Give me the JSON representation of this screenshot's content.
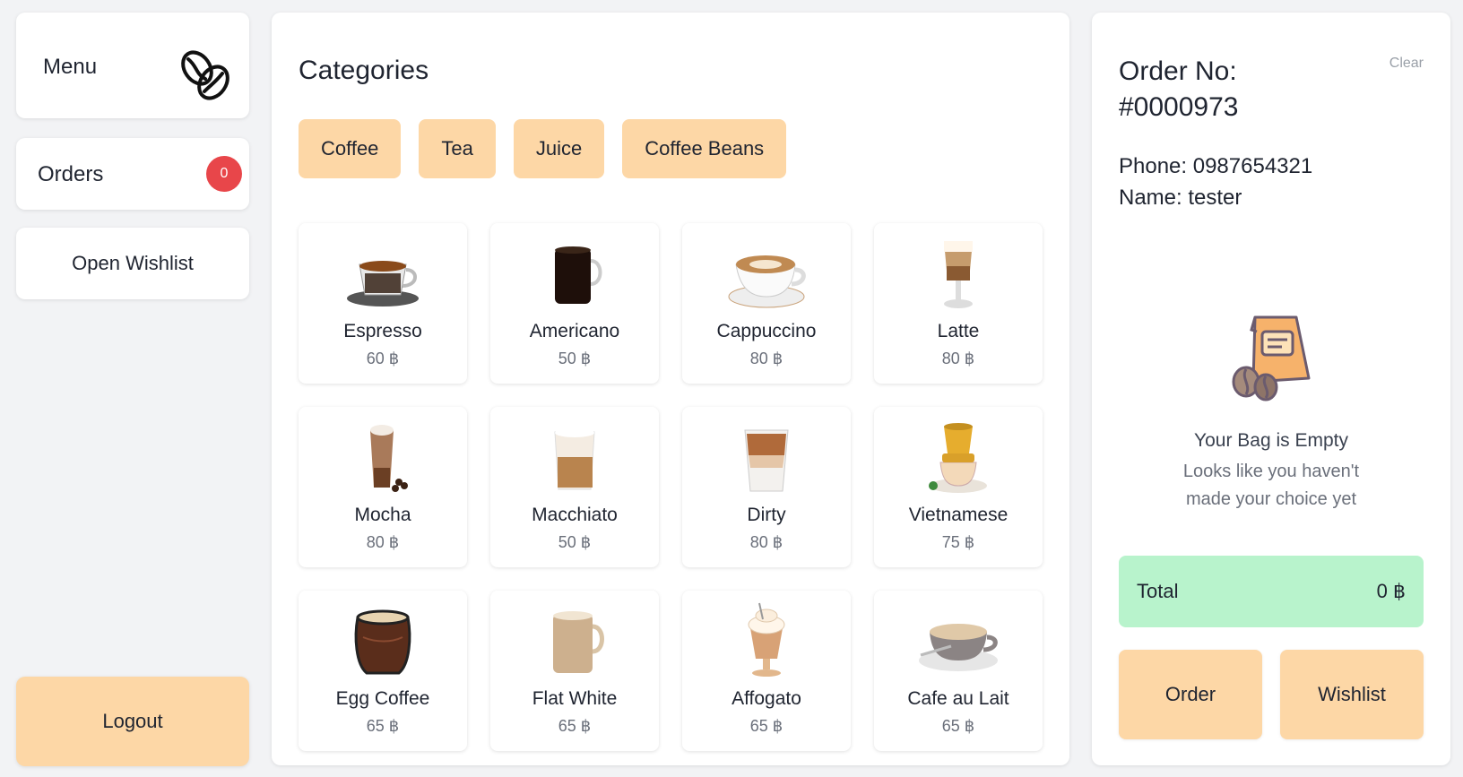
{
  "colors": {
    "accent": "#fdd7a6",
    "badge": "#e8464a",
    "total_bg": "#b8f3cc",
    "page_bg": "#f2f3f5"
  },
  "sidebar": {
    "menu_label": "Menu",
    "menu_icon": "coffee-beans-icon",
    "orders_label": "Orders",
    "orders_count": "0",
    "open_wishlist_label": "Open Wishlist",
    "logout_label": "Logout"
  },
  "main": {
    "title": "Categories",
    "categories": [
      "Coffee",
      "Tea",
      "Juice",
      "Coffee Beans"
    ],
    "products": [
      {
        "name": "Espresso",
        "price": "60 ฿",
        "image": "espresso-cup"
      },
      {
        "name": "Americano",
        "price": "50 ฿",
        "image": "americano-mug"
      },
      {
        "name": "Cappuccino",
        "price": "80 ฿",
        "image": "cappuccino-cup"
      },
      {
        "name": "Latte",
        "price": "80 ฿",
        "image": "latte-glass"
      },
      {
        "name": "Mocha",
        "price": "80 ฿",
        "image": "mocha-glass"
      },
      {
        "name": "Macchiato",
        "price": "50 ฿",
        "image": "macchiato-glass"
      },
      {
        "name": "Dirty",
        "price": "80 ฿",
        "image": "dirty-glass"
      },
      {
        "name": "Vietnamese",
        "price": "75 ฿",
        "image": "vietnamese-phin"
      },
      {
        "name": "Egg Coffee",
        "price": "65 ฿",
        "image": "egg-coffee-glass"
      },
      {
        "name": "Flat White",
        "price": "65 ฿",
        "image": "flat-white-mug"
      },
      {
        "name": "Affogato",
        "price": "65 ฿",
        "image": "affogato-glass"
      },
      {
        "name": "Cafe au Lait",
        "price": "65 ฿",
        "image": "cafe-au-lait-cup"
      }
    ]
  },
  "order": {
    "clear_label": "Clear",
    "title": "Order No: #0000973",
    "phone": "Phone: 0987654321",
    "name": "Name: tester",
    "empty_icon": "empty-bag-icon",
    "empty_title": "Your Bag is Empty",
    "empty_subtitle": "Looks like you haven't made your choice yet",
    "total_label": "Total",
    "total_value": "0 ฿",
    "order_button": "Order",
    "wishlist_button": "Wishlist"
  }
}
